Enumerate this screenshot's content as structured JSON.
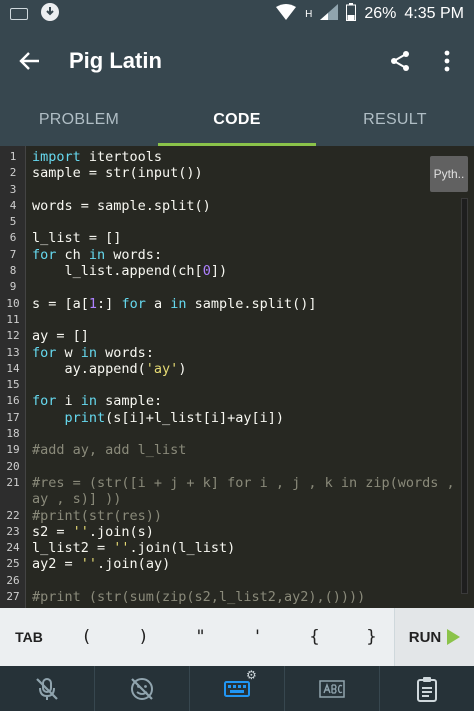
{
  "status_bar": {
    "network_letter": "H",
    "battery": "26%",
    "time": "4:35 PM"
  },
  "toolbar": {
    "title": "Pig Latin"
  },
  "tabs": [
    {
      "label": "PROBLEM",
      "active": false
    },
    {
      "label": "CODE",
      "active": true
    },
    {
      "label": "RESULT",
      "active": false
    }
  ],
  "editor": {
    "language_button": "Pyth..",
    "lines": [
      {
        "n": "1",
        "tokens": [
          {
            "t": "import",
            "c": "kw"
          },
          {
            "t": " itertools",
            "c": ""
          }
        ]
      },
      {
        "n": "2",
        "tokens": [
          {
            "t": "sample = str(input())",
            "c": ""
          }
        ]
      },
      {
        "n": "3",
        "tokens": []
      },
      {
        "n": "4",
        "tokens": [
          {
            "t": "words = sample.split()",
            "c": ""
          }
        ]
      },
      {
        "n": "5",
        "tokens": []
      },
      {
        "n": "6",
        "tokens": [
          {
            "t": "l_list = []",
            "c": ""
          }
        ]
      },
      {
        "n": "7",
        "tokens": [
          {
            "t": "for",
            "c": "kw"
          },
          {
            "t": " ch ",
            "c": ""
          },
          {
            "t": "in",
            "c": "kw"
          },
          {
            "t": " words:",
            "c": ""
          }
        ]
      },
      {
        "n": "8",
        "tokens": [
          {
            "t": "    l_list.append(ch[",
            "c": ""
          },
          {
            "t": "0",
            "c": "num"
          },
          {
            "t": "])",
            "c": ""
          }
        ]
      },
      {
        "n": "9",
        "tokens": []
      },
      {
        "n": "10",
        "tokens": [
          {
            "t": "s = [a[",
            "c": ""
          },
          {
            "t": "1",
            "c": "num"
          },
          {
            "t": ":] ",
            "c": ""
          },
          {
            "t": "for",
            "c": "kw"
          },
          {
            "t": " a ",
            "c": ""
          },
          {
            "t": "in",
            "c": "kw"
          },
          {
            "t": " sample.split()]",
            "c": ""
          }
        ]
      },
      {
        "n": "11",
        "tokens": []
      },
      {
        "n": "12",
        "tokens": [
          {
            "t": "ay = []",
            "c": ""
          }
        ]
      },
      {
        "n": "13",
        "tokens": [
          {
            "t": "for",
            "c": "kw"
          },
          {
            "t": " w ",
            "c": ""
          },
          {
            "t": "in",
            "c": "kw"
          },
          {
            "t": " words:",
            "c": ""
          }
        ]
      },
      {
        "n": "14",
        "tokens": [
          {
            "t": "    ay.append(",
            "c": ""
          },
          {
            "t": "'ay'",
            "c": "str"
          },
          {
            "t": ")",
            "c": ""
          }
        ]
      },
      {
        "n": "15",
        "tokens": []
      },
      {
        "n": "16",
        "tokens": [
          {
            "t": "for",
            "c": "kw"
          },
          {
            "t": " i ",
            "c": ""
          },
          {
            "t": "in",
            "c": "kw"
          },
          {
            "t": " sample:",
            "c": ""
          }
        ]
      },
      {
        "n": "17",
        "tokens": [
          {
            "t": "    ",
            "c": ""
          },
          {
            "t": "print",
            "c": "kw"
          },
          {
            "t": "(s[i]+l_list[i]+ay[i])",
            "c": ""
          }
        ]
      },
      {
        "n": "18",
        "tokens": []
      },
      {
        "n": "19",
        "tokens": [
          {
            "t": "#add ay, add l_list",
            "c": "cm"
          }
        ]
      },
      {
        "n": "20",
        "tokens": []
      },
      {
        "n": "21",
        "tokens": [
          {
            "t": "#res = (str([i + j + k] for i , j , k in zip(words ,",
            "c": "cm"
          }
        ]
      },
      {
        "n": "",
        "tokens": [
          {
            "t": "ay , s)] ))",
            "c": "cm"
          }
        ]
      },
      {
        "n": "22",
        "tokens": [
          {
            "t": "#print(str(res))",
            "c": "cm"
          }
        ]
      },
      {
        "n": "23",
        "tokens": [
          {
            "t": "s2 = ",
            "c": ""
          },
          {
            "t": "''",
            "c": "str"
          },
          {
            "t": ".join(s)",
            "c": ""
          }
        ]
      },
      {
        "n": "24",
        "tokens": [
          {
            "t": "l_list2 = ",
            "c": ""
          },
          {
            "t": "''",
            "c": "str"
          },
          {
            "t": ".join(l_list)",
            "c": ""
          }
        ]
      },
      {
        "n": "25",
        "tokens": [
          {
            "t": "ay2 = ",
            "c": ""
          },
          {
            "t": "''",
            "c": "str"
          },
          {
            "t": ".join(ay)",
            "c": ""
          }
        ]
      },
      {
        "n": "26",
        "tokens": []
      },
      {
        "n": "27",
        "tokens": [
          {
            "t": "#print (str(sum(zip(s2,l_list2,ay2),())))",
            "c": "cm"
          }
        ]
      }
    ]
  },
  "symbol_bar": {
    "tab_label": "TAB",
    "symbols": [
      "(",
      ")",
      "\"",
      "'",
      "{",
      "}"
    ],
    "run_label": "RUN"
  },
  "icons": {
    "back": "arrow-left-icon",
    "share": "share-icon",
    "more": "more-vert-icon",
    "mic_off": "mic-off-icon",
    "emoji_off": "emoji-off-icon",
    "keyboard": "keyboard-icon",
    "settings": "gear-icon",
    "spellcheck": "spellcheck-icon",
    "clipboard": "clipboard-icon"
  },
  "colors": {
    "accent": "#8bc34a",
    "keyboard_active": "#2196f3"
  }
}
